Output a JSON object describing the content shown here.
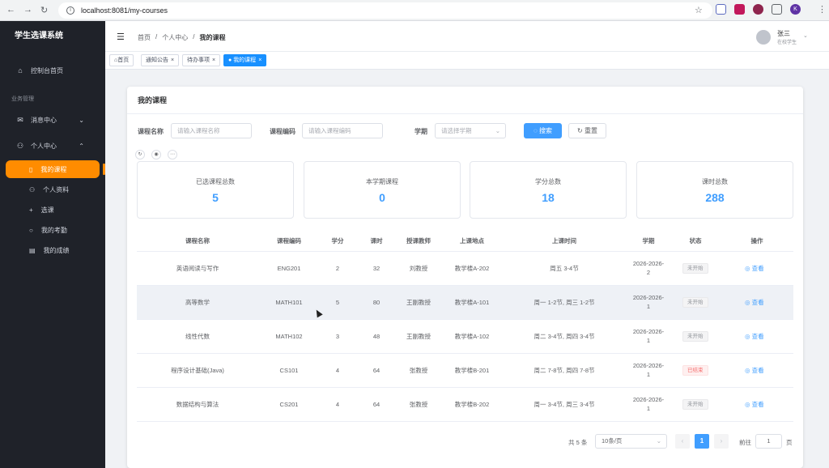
{
  "browser": {
    "url": "localhost:8081/my-courses",
    "nav_back": "←",
    "nav_forward": "→",
    "nav_reload": "↻",
    "ext_profile_letter": "K"
  },
  "sidebar": {
    "brand": "学生选课系统",
    "dashboard": "控制台首页",
    "group_label": "业务管理",
    "message_center": "消息中心",
    "personal_center": "个人中心",
    "sub_items": [
      {
        "label": "我的课程",
        "icon": "book-icon"
      },
      {
        "label": "个人资料",
        "icon": "user-icon"
      },
      {
        "label": "选课",
        "icon": "plus-icon"
      },
      {
        "label": "我的考勤",
        "icon": "search-icon"
      },
      {
        "label": "我的成绩",
        "icon": "document-icon"
      }
    ]
  },
  "header": {
    "breadcrumbs": [
      "首页",
      "个人中心",
      "我的课程"
    ],
    "breadcrumb_sep": "/",
    "user_name": "张三",
    "user_role": "在校学生"
  },
  "tags": [
    {
      "label": "首页",
      "closable": false
    },
    {
      "label": "通知公告",
      "closable": true
    },
    {
      "label": "待办事项",
      "closable": true
    },
    {
      "label": "我的课程",
      "closable": true,
      "active": true
    }
  ],
  "page": {
    "title": "我的课程",
    "filters": {
      "course_name_label": "课程名称",
      "course_name_placeholder": "请输入课程名称",
      "course_code_label": "课程编码",
      "course_code_placeholder": "请输入课程编码",
      "term_label": "学期",
      "term_placeholder": "请选择学期",
      "search_btn": "搜索",
      "reset_btn": "重置"
    },
    "stats": [
      {
        "label": "已选课程总数",
        "value": "5"
      },
      {
        "label": "本学期课程",
        "value": "0"
      },
      {
        "label": "学分总数",
        "value": "18"
      },
      {
        "label": "课时总数",
        "value": "288"
      }
    ],
    "table": {
      "columns": [
        "课程名称",
        "课程编码",
        "学分",
        "课时",
        "授课教师",
        "上课地点",
        "上课时间",
        "学期",
        "状态",
        "操作"
      ],
      "rows": [
        {
          "name": "英语阅读与写作",
          "code": "ENG201",
          "credit": "2",
          "hours": "32",
          "teacher": "刘教授",
          "location": "教学楼A-202",
          "time": "周五 3-4节",
          "term1": "2026-2026-",
          "term2": "2",
          "status": "未开始",
          "status_type": "pending",
          "action": "查看"
        },
        {
          "name": "高等数学",
          "code": "MATH101",
          "credit": "5",
          "hours": "80",
          "teacher": "王副教授",
          "location": "教学楼A-101",
          "time": "周一 1-2节, 周三 1-2节",
          "term1": "2026-2026-",
          "term2": "1",
          "status": "未开始",
          "status_type": "pending",
          "action": "查看"
        },
        {
          "name": "线性代数",
          "code": "MATH102",
          "credit": "3",
          "hours": "48",
          "teacher": "王副教授",
          "location": "教学楼A-102",
          "time": "周二 3-4节, 周四 3-4节",
          "term1": "2026-2026-",
          "term2": "1",
          "status": "未开始",
          "status_type": "pending",
          "action": "查看"
        },
        {
          "name": "程序设计基础(Java)",
          "code": "CS101",
          "credit": "4",
          "hours": "64",
          "teacher": "张教授",
          "location": "教学楼B-201",
          "time": "周二 7-8节, 周四 7-8节",
          "term1": "2026-2026-",
          "term2": "1",
          "status": "已结束",
          "status_type": "ended",
          "action": "查看"
        },
        {
          "name": "数据结构与算法",
          "code": "CS201",
          "credit": "4",
          "hours": "64",
          "teacher": "张教授",
          "location": "教学楼B-202",
          "time": "周一 3-4节, 周三 3-4节",
          "term1": "2026-2026-",
          "term2": "1",
          "status": "未开始",
          "status_type": "pending",
          "action": "查看"
        }
      ]
    },
    "pagination": {
      "total": "共 5 条",
      "page_size": "10条/页",
      "current": "1",
      "goto_label": "前往",
      "goto_value": "1",
      "page_unit": "页"
    }
  }
}
